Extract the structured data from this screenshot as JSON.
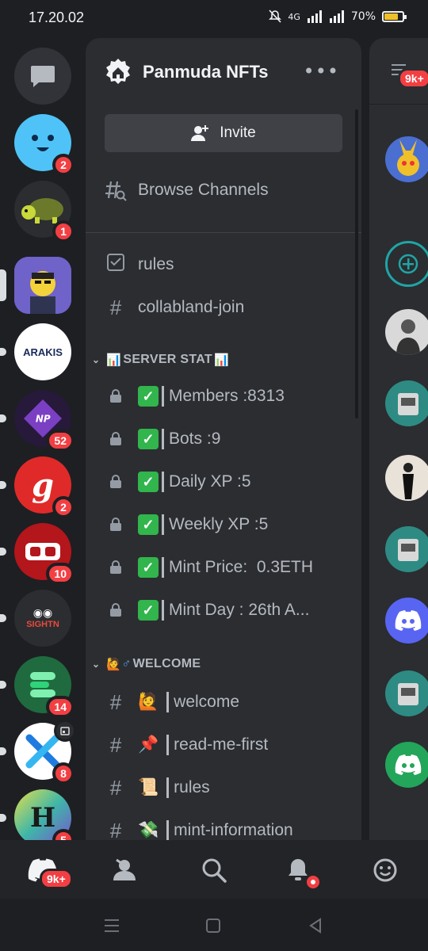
{
  "status": {
    "time": "17.20.02",
    "battery": "70%",
    "network": "4G"
  },
  "rail": {
    "servers": [
      {
        "name": "dm-button",
        "badge": ""
      },
      {
        "name": "server-smiley",
        "badge": "2"
      },
      {
        "name": "server-turtle",
        "badge": "1"
      },
      {
        "name": "server-panmuda",
        "badge": ""
      },
      {
        "name": "server-arakis",
        "label": "ARAKIS",
        "badge": ""
      },
      {
        "name": "server-np",
        "label": "NP",
        "badge": "52"
      },
      {
        "name": "server-g",
        "badge": "2"
      },
      {
        "name": "server-vr",
        "badge": "10"
      },
      {
        "name": "server-sightn",
        "label": "SIGHTN",
        "badge": ""
      },
      {
        "name": "server-e",
        "badge": "14"
      },
      {
        "name": "server-x",
        "badge": "8"
      },
      {
        "name": "server-h",
        "badge": "5"
      }
    ]
  },
  "panel": {
    "title": "Panmuda NFTs",
    "invite_label": "Invite",
    "browse_label": "Browse Channels",
    "top_channels": [
      "rules",
      "collabland-join"
    ],
    "server_stat_category": "SERVER STAT",
    "stat_channels": [
      "Members :8313",
      "Bots :9",
      "Daily XP :5",
      "Weekly XP :5",
      "Mint Price:  0.3ETH",
      "Mint Day : 26th A..."
    ],
    "welcome_category": "WELCOME",
    "welcome_channels": [
      {
        "emoji": "🙋",
        "label": "welcome"
      },
      {
        "emoji": "📌",
        "label": "read-me-first"
      },
      {
        "emoji": "📜",
        "label": "rules"
      },
      {
        "emoji": "💸",
        "label": "mint-information"
      }
    ]
  },
  "peek": {
    "header_badge": "9k+"
  },
  "bottomnav": {
    "home_badge": "9k+"
  },
  "colors": {
    "badge": "#f23f43",
    "panel": "#2b2d31",
    "rail": "#1e1f22",
    "blurple": "#5865f2",
    "green": "#23a55a"
  }
}
